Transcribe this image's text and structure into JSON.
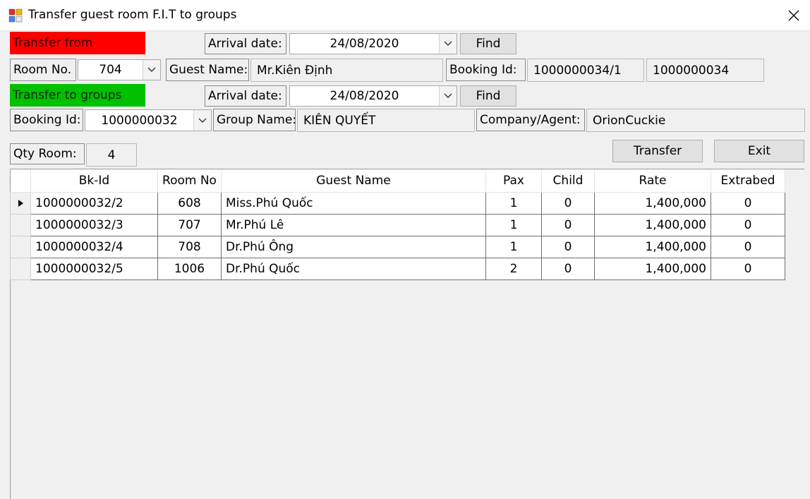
{
  "window": {
    "title": "Transfer guest room F.I.T to groups"
  },
  "from": {
    "status_label": "Transfer from",
    "status_color": "#ff0000",
    "arrival_label": "Arrival date:",
    "arrival_date": "24/08/2020",
    "find_label": "Find",
    "room_label": "Room No.",
    "room_no": "704",
    "guest_label": "Guest Name:",
    "guest_name": "Mr.Kiên Định",
    "booking_label": "Booking Id:",
    "booking_id": "1000000034/1",
    "booking_master": "1000000034"
  },
  "to": {
    "status_label": "Transfer to groups",
    "status_color": "#00c000",
    "arrival_label": "Arrival date:",
    "arrival_date": "24/08/2020",
    "find_label": "Find",
    "booking_label": "Booking Id:",
    "booking_id": "1000000032",
    "group_label": "Group Name:",
    "group_name": "KIÊN QUYẾT",
    "company_label": "Company/Agent:",
    "company_name": "OrionCuckie"
  },
  "qty": {
    "label": "Qty Room:",
    "value": "4"
  },
  "buttons": {
    "transfer": "Transfer",
    "exit": "Exit"
  },
  "grid": {
    "columns": [
      "Bk-Id",
      "Room No",
      "Guest Name",
      "Pax",
      "Child",
      "Rate",
      "Extrabed"
    ],
    "rows": [
      [
        "1000000032/2",
        "608",
        "Miss.Phú Quốc",
        "1",
        "0",
        "1,400,000",
        "0"
      ],
      [
        "1000000032/3",
        "707",
        "Mr.Phú Lê",
        "1",
        "0",
        "1,400,000",
        "0"
      ],
      [
        "1000000032/4",
        "708",
        "Dr.Phú Ông",
        "1",
        "0",
        "1,400,000",
        "0"
      ],
      [
        "1000000032/5",
        "1006",
        "Dr.Phú Quốc",
        "2",
        "0",
        "1,400,000",
        "0"
      ]
    ],
    "selected_row": 0
  }
}
